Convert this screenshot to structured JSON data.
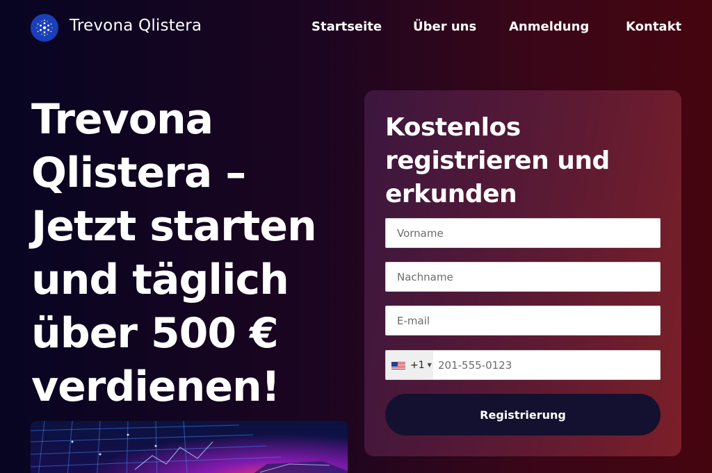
{
  "brand": {
    "name": "Trevona Qlistera"
  },
  "nav": {
    "items": [
      "Startseite",
      "Über uns",
      "Anmeldung",
      "Kontakt"
    ]
  },
  "hero": {
    "title": "Trevona Qlistera – Jetzt starten und täglich über 500 € verdienen!"
  },
  "form": {
    "title": "Kostenlos registrieren und erkunden",
    "first_name_placeholder": "Vorname",
    "last_name_placeholder": "Nachname",
    "email_placeholder": "E-mail",
    "phone_dial_code": "+1",
    "phone_placeholder": "201-555-0123",
    "submit_label": "Registrierung"
  },
  "colors": {
    "logo_blue": "#1a3fb8",
    "button_dark": "#13112f",
    "card_start": "#3b163f",
    "card_end": "#7b1f28"
  },
  "icons": {
    "logo": "cardano-logo-icon",
    "flag": "us-flag-icon",
    "dropdown": "caret-down-icon"
  }
}
